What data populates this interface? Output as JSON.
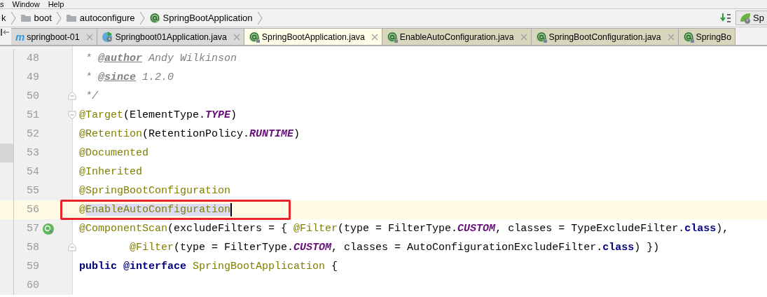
{
  "menu": [
    {
      "label": "s"
    },
    {
      "label": "Window"
    },
    {
      "label": "Help"
    }
  ],
  "breadcrumbs": [
    {
      "label": "k",
      "kind": "text"
    },
    {
      "label": "boot",
      "kind": "folder"
    },
    {
      "label": "autoconfigure",
      "kind": "folder"
    },
    {
      "label": "SpringBootApplication",
      "kind": "annotation"
    }
  ],
  "toolbar": {
    "run_config": {
      "label": "Sp"
    }
  },
  "tabs": [
    {
      "label": "springboot-01",
      "kind": "module",
      "icon_text": "m",
      "selected": false,
      "closable": true,
      "color": "#d9d9d9"
    },
    {
      "label": "Springboot01Application.java",
      "kind": "runnable",
      "selected": false,
      "closable": true,
      "color": "#d9d9d9"
    },
    {
      "label": "SpringBootApplication.java",
      "kind": "annotation",
      "selected": true,
      "closable": true,
      "color": "#fffde8"
    },
    {
      "label": "EnableAutoConfiguration.java",
      "kind": "annotation",
      "selected": false,
      "closable": true,
      "color": "#d8d6bd"
    },
    {
      "label": "SpringBootConfiguration.java",
      "kind": "annotation",
      "selected": false,
      "closable": true,
      "color": "#d8d6bd"
    },
    {
      "label": "SpringBo",
      "kind": "annotation",
      "selected": false,
      "closable": false,
      "color": "#d8d6bd"
    }
  ],
  "editor": {
    "lines": [
      {
        "number": "48",
        "current": false,
        "panel_selected": false,
        "segments": [
          {
            "text": " * ",
            "kind": "comment"
          },
          {
            "text": "@author",
            "kind": "doctag"
          },
          {
            "text": " Andy Wilkinson",
            "kind": "comment"
          }
        ]
      },
      {
        "number": "49",
        "current": false,
        "panel_selected": false,
        "segments": [
          {
            "text": " * ",
            "kind": "comment"
          },
          {
            "text": "@since",
            "kind": "doctag"
          },
          {
            "text": " 1.2.0",
            "kind": "comment"
          }
        ]
      },
      {
        "number": "50",
        "current": false,
        "panel_selected": false,
        "markers": [
          {
            "kind": "fold-end"
          }
        ],
        "segments": [
          {
            "text": " */",
            "kind": "comment"
          }
        ]
      },
      {
        "number": "51",
        "current": false,
        "panel_selected": false,
        "markers": [
          {
            "kind": "fold-start"
          }
        ],
        "segments": [
          {
            "text": "@Target",
            "kind": "annotation"
          },
          {
            "text": "(ElementType.",
            "kind": "plain"
          },
          {
            "text": "TYPE",
            "kind": "constant"
          },
          {
            "text": ")",
            "kind": "plain"
          }
        ]
      },
      {
        "number": "52",
        "current": false,
        "panel_selected": false,
        "segments": [
          {
            "text": "@Retention",
            "kind": "annotation"
          },
          {
            "text": "(RetentionPolicy.",
            "kind": "plain"
          },
          {
            "text": "RUNTIME",
            "kind": "constant"
          },
          {
            "text": ")",
            "kind": "plain"
          }
        ]
      },
      {
        "number": "53",
        "current": false,
        "panel_selected": true,
        "segments": [
          {
            "text": "@Documented",
            "kind": "annotation"
          }
        ]
      },
      {
        "number": "54",
        "current": false,
        "panel_selected": false,
        "segments": [
          {
            "text": "@Inherited",
            "kind": "annotation"
          }
        ]
      },
      {
        "number": "55",
        "current": false,
        "panel_selected": false,
        "segments": [
          {
            "text": "@SpringBootConfiguration",
            "kind": "annotation"
          }
        ]
      },
      {
        "number": "56",
        "current": true,
        "panel_selected": false,
        "boxed": true,
        "caret": true,
        "segments": [
          {
            "text": "@",
            "kind": "annotation",
            "selected": false
          },
          {
            "text": "EnableAutoConfiguration",
            "kind": "annotation",
            "selected": true
          }
        ]
      },
      {
        "number": "57",
        "current": false,
        "panel_selected": false,
        "markers": [
          {
            "kind": "bean"
          }
        ],
        "segments": [
          {
            "text": "@ComponentScan",
            "kind": "annotation"
          },
          {
            "text": "(excludeFilters = { ",
            "kind": "plain"
          },
          {
            "text": "@Filter",
            "kind": "annotation"
          },
          {
            "text": "(type = FilterType.",
            "kind": "plain"
          },
          {
            "text": "CUSTOM",
            "kind": "constant"
          },
          {
            "text": ", classes = TypeExcludeFilter.",
            "kind": "plain"
          },
          {
            "text": "class",
            "kind": "keyword"
          },
          {
            "text": "),",
            "kind": "plain"
          }
        ]
      },
      {
        "number": "58",
        "current": false,
        "panel_selected": false,
        "markers": [
          {
            "kind": "fold-end"
          }
        ],
        "segments": [
          {
            "text": "        @Filter",
            "kind": "annotation"
          },
          {
            "text": "(type = FilterType.",
            "kind": "plain"
          },
          {
            "text": "CUSTOM",
            "kind": "constant"
          },
          {
            "text": ", classes = AutoConfigurationExcludeFilter.",
            "kind": "plain"
          },
          {
            "text": "class",
            "kind": "keyword"
          },
          {
            "text": ") })",
            "kind": "plain"
          }
        ]
      },
      {
        "number": "59",
        "current": false,
        "panel_selected": false,
        "segments": [
          {
            "text": "public @interface",
            "kind": "keyword"
          },
          {
            "text": " SpringBootApplication",
            "kind": "annotation"
          },
          {
            "text": " {",
            "kind": "plain"
          }
        ]
      },
      {
        "number": "60",
        "current": false,
        "panel_selected": false
      }
    ]
  }
}
